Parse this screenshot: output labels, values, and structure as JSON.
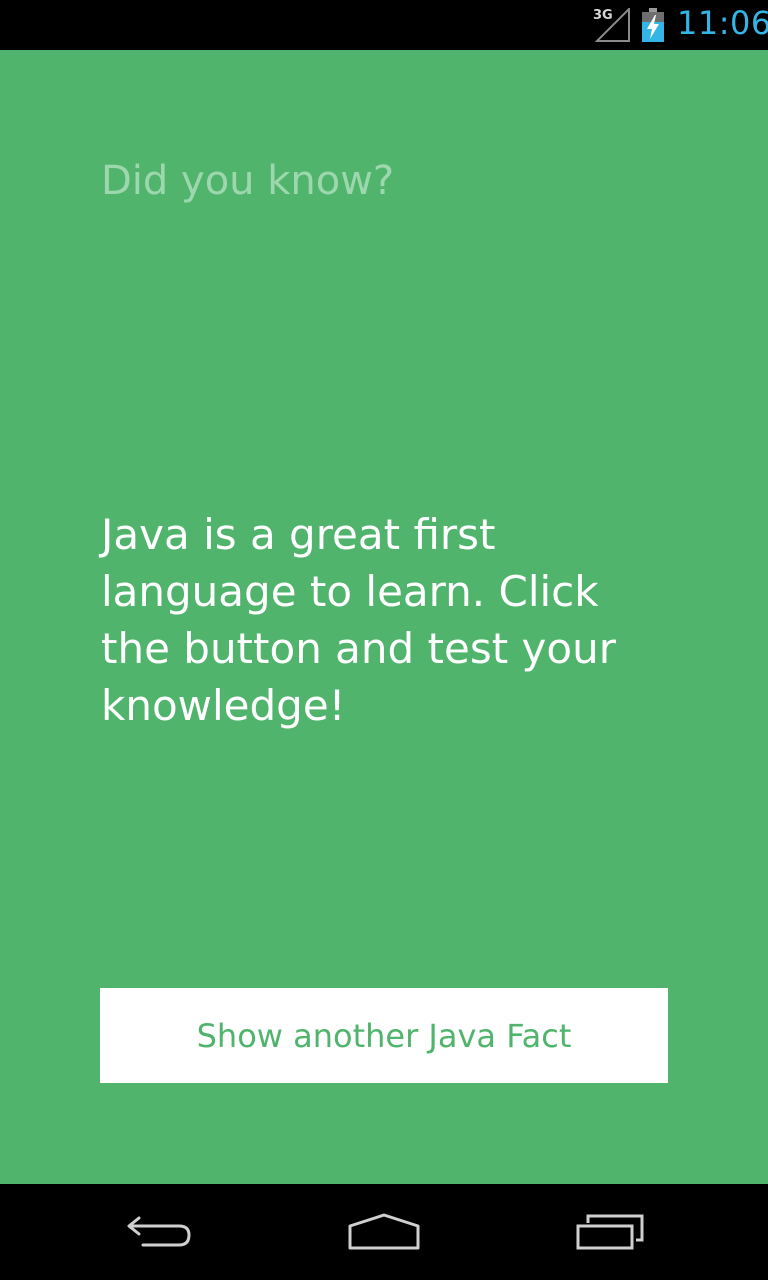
{
  "status_bar": {
    "network_type": "3G",
    "time": "11:06",
    "signal_icon": "signal-strength-icon",
    "battery_icon": "battery-charging-icon",
    "clock_color": "#33b5e5"
  },
  "main": {
    "title": "Did you know?",
    "fact_text": "Java is a great first language to learn. Click the button and test your knowledge!",
    "button_label": "Show another Java Fact",
    "background_color": "#51b46d",
    "button_text_color": "#51b46d"
  },
  "nav_bar": {
    "back_icon": "back-icon",
    "home_icon": "home-icon",
    "recents_icon": "recent-apps-icon"
  }
}
